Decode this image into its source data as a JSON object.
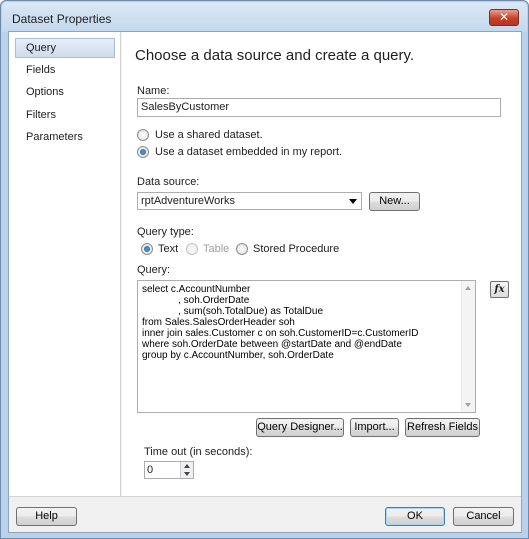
{
  "window": {
    "title": "Dataset Properties",
    "close_glyph": "✕"
  },
  "nav": {
    "items": [
      {
        "label": "Query",
        "selected": true
      },
      {
        "label": "Fields"
      },
      {
        "label": "Options"
      },
      {
        "label": "Filters"
      },
      {
        "label": "Parameters"
      }
    ]
  },
  "content": {
    "heading": "Choose a data source and create a query.",
    "name_label": "Name:",
    "name_value": "SalesByCustomer",
    "source_options": [
      {
        "label": "Use a shared dataset.",
        "checked": false
      },
      {
        "label": "Use a dataset embedded in my report.",
        "checked": true
      }
    ],
    "data_source_label": "Data source:",
    "data_source_value": "rptAdventureWorks",
    "new_button": "New...",
    "query_type_label": "Query type:",
    "query_types": [
      {
        "label": "Text",
        "checked": true
      },
      {
        "label": "Table",
        "disabled": true
      },
      {
        "label": "Stored Procedure"
      }
    ],
    "query_label": "Query:",
    "query_text": "select c.AccountNumber\n             , soh.OrderDate\n             , sum(soh.TotalDue) as TotalDue\nfrom Sales.SalesOrderHeader soh\ninner join sales.Customer c on soh.CustomerID=c.CustomerID\nwhere soh.OrderDate between @startDate and @endDate\ngroup by c.AccountNumber, soh.OrderDate",
    "fx_label": "fx",
    "query_designer_button": "Query Designer...",
    "import_button": "Import...",
    "refresh_fields_button": "Refresh Fields",
    "timeout_label": "Time out (in seconds):",
    "timeout_value": "0"
  },
  "footer": {
    "help": "Help",
    "ok": "OK",
    "cancel": "Cancel"
  },
  "colors": {
    "title_bar": "#c4d8ee",
    "close_button": "#c6412a",
    "selected_nav": "#cfdcec"
  }
}
